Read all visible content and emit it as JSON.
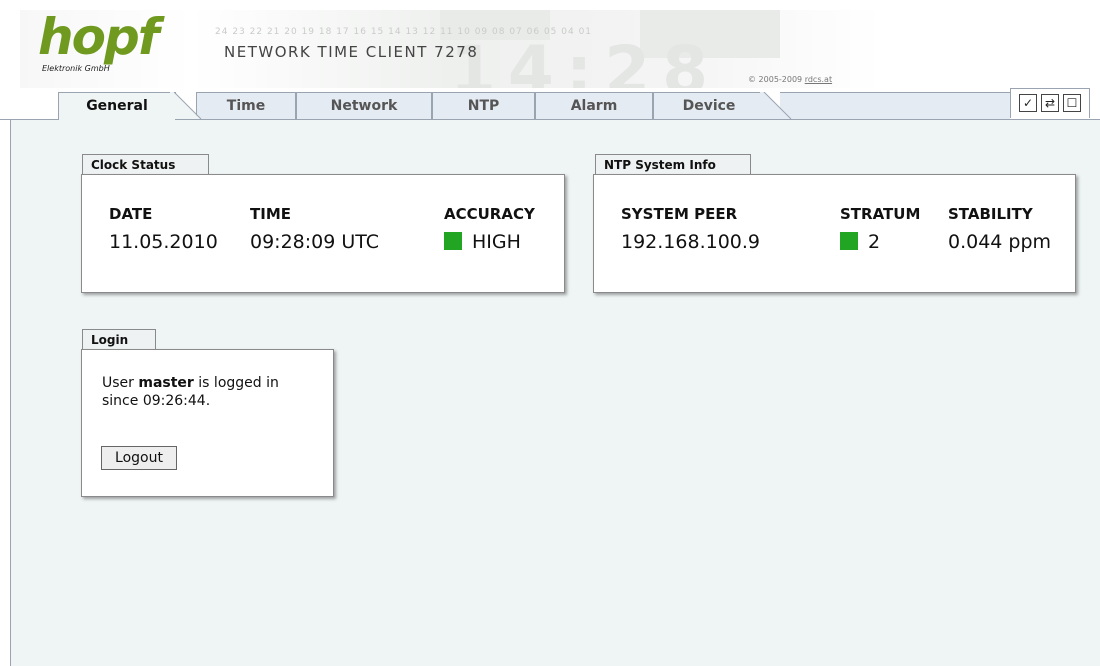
{
  "header": {
    "logo_text": "hopf",
    "logo_sub": "Elektronik GmbH",
    "product_title": "NETWORK TIME CLIENT 7278",
    "scale_numbers": "24 23 22 21 20 19 18 17 16 15 14 13 12 11 10 09 08 07 06 05 04 01",
    "ghost_time": "14:28",
    "copyright_prefix": "© 2005-2009",
    "copyright_link": "rdcs.at"
  },
  "tabs": [
    {
      "label": "General",
      "active": true
    },
    {
      "label": "Time",
      "active": false
    },
    {
      "label": "Network",
      "active": false
    },
    {
      "label": "NTP",
      "active": false
    },
    {
      "label": "Alarm",
      "active": false
    },
    {
      "label": "Device",
      "active": false
    }
  ],
  "toolbar": {
    "buttons": [
      {
        "icon": "check-icon",
        "glyph": "✓"
      },
      {
        "icon": "refresh-icon",
        "glyph": "⇄"
      },
      {
        "icon": "window-icon",
        "glyph": "☐"
      }
    ]
  },
  "clock_status": {
    "title": "Clock Status",
    "date_label": "DATE",
    "date_value": "11.05.2010",
    "time_label": "TIME",
    "time_value": "09:28:09 UTC",
    "accuracy_label": "ACCURACY",
    "accuracy_value": "HIGH",
    "accuracy_color": "#22a522"
  },
  "ntp_info": {
    "title": "NTP System Info",
    "peer_label": "SYSTEM PEER",
    "peer_value": "192.168.100.9",
    "stratum_label": "STRATUM",
    "stratum_value": "2",
    "stratum_color": "#22a522",
    "stability_label": "STABILITY",
    "stability_value": "0.044 ppm"
  },
  "login": {
    "title": "Login",
    "text_prefix": "User",
    "username": "master",
    "text_suffix": "is logged in",
    "since_text": "since 09:26:44.",
    "logout_label": "Logout"
  },
  "colors": {
    "brand_green": "#6f9a1f",
    "content_bg": "#eff4f4",
    "tab_bg": "#e5ebf2"
  }
}
